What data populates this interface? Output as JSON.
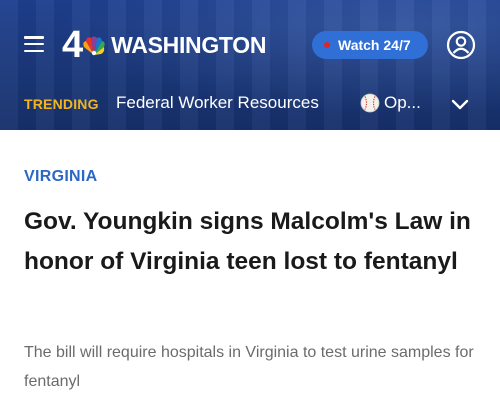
{
  "header": {
    "logo": {
      "number": "4",
      "city": "WASHINGTON"
    },
    "watch_button": {
      "label": "Watch 24/7"
    }
  },
  "trending": {
    "label": "TRENDING",
    "items": [
      {
        "label": "Federal Worker Resources"
      },
      {
        "label": "Op..."
      }
    ]
  },
  "article": {
    "category": "VIRGINIA",
    "headline": "Gov. Youngkin signs Malcolm's Law in honor of Virginia teen lost to fentanyl",
    "subhead": "The bill will require hospitals in Virginia to test urine samples for fentanyl"
  },
  "colors": {
    "header_bg": "#1e3f8f",
    "watch_button_bg": "#2f6fd6",
    "trending_accent": "#f3b51d",
    "category": "#2b67c4",
    "live_dot": "#e02424"
  },
  "icons": [
    "hamburger-menu-icon",
    "nbc-peacock-icon",
    "live-dot-icon",
    "account-icon",
    "baseball-icon",
    "chevron-down-icon"
  ]
}
